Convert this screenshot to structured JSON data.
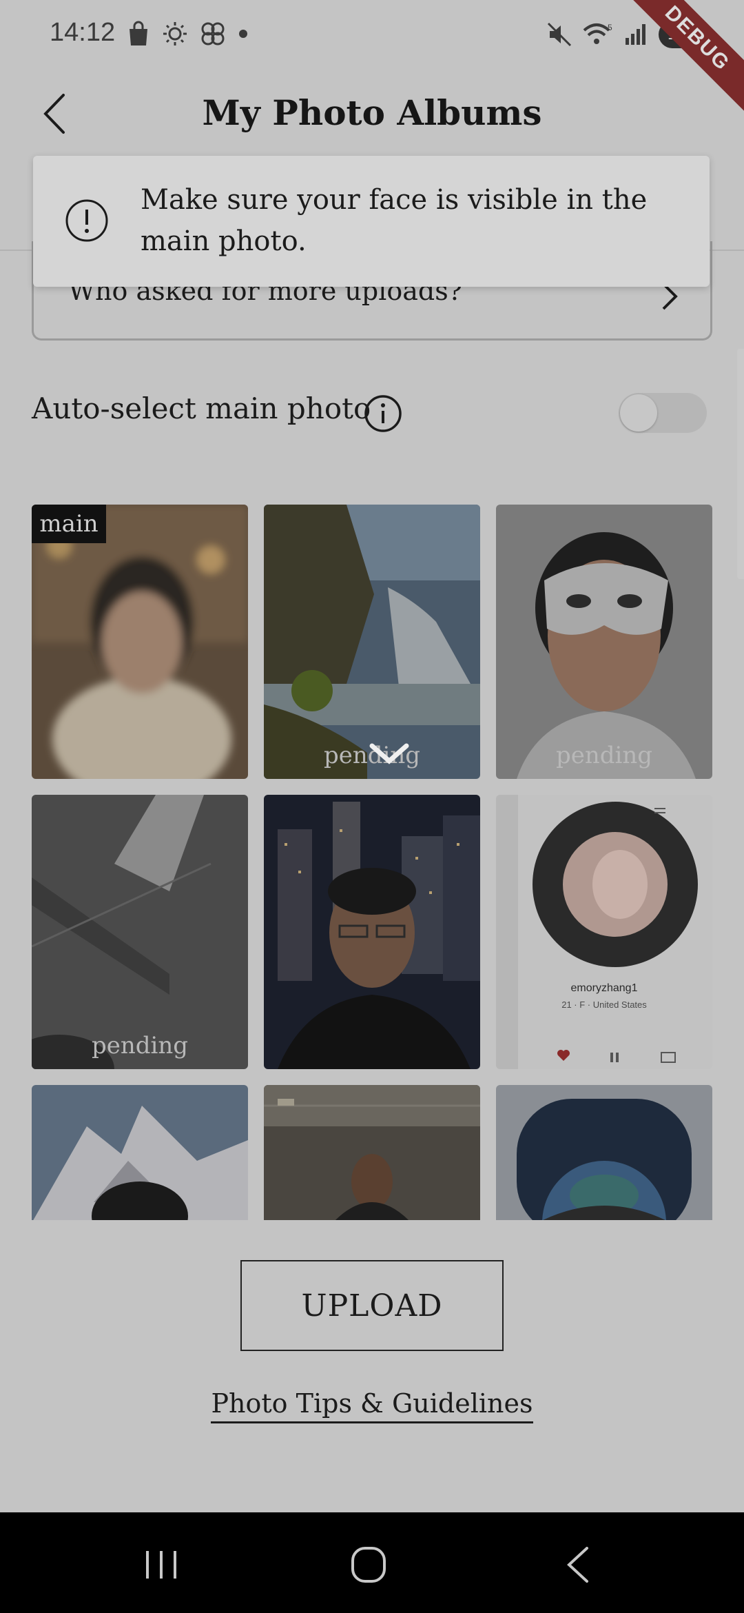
{
  "status_bar": {
    "time": "14:12",
    "left_icons": [
      "shopping-bag-icon",
      "brightness-icon",
      "pinwheel-icon",
      "dot-icon"
    ],
    "right_icons": [
      "muted-icon",
      "wifi-icon",
      "signal-icon",
      "battery-icon"
    ],
    "wifi_label": "5",
    "battery": "100",
    "debug_banner": "DEBUG"
  },
  "header": {
    "title": "My Photo Albums"
  },
  "toast": {
    "message": "Make sure your face is visible in the main photo."
  },
  "request_card": {
    "text": "Who asked for more uploads?"
  },
  "auto_select": {
    "label": "Auto-select main photo",
    "enabled": false
  },
  "photos": [
    {
      "label": "main",
      "description": "blurred man in cafe"
    },
    {
      "label": "pending",
      "description": "waterfall landscape"
    },
    {
      "label": "pending",
      "description": "man wearing white mask"
    },
    {
      "label": "pending",
      "description": "dim ceiling light"
    },
    {
      "label": "",
      "description": "man in city at night"
    },
    {
      "label": "",
      "description": "profile screen screenshot",
      "profile_name": "emoryzhang1",
      "profile_meta": "21 · F · United States"
    },
    {
      "label": "",
      "description": "mountain snow"
    },
    {
      "label": "",
      "description": "man with dreadlocks in hangar"
    },
    {
      "label": "",
      "description": "man in spaceship window"
    }
  ],
  "upload_button": "UPLOAD",
  "tips_link": "Photo Tips & Guidelines",
  "colors": {
    "overlay_background": "#c4c4c4",
    "toast_background": "#d5d5d5",
    "nav_bar": "#000000"
  }
}
